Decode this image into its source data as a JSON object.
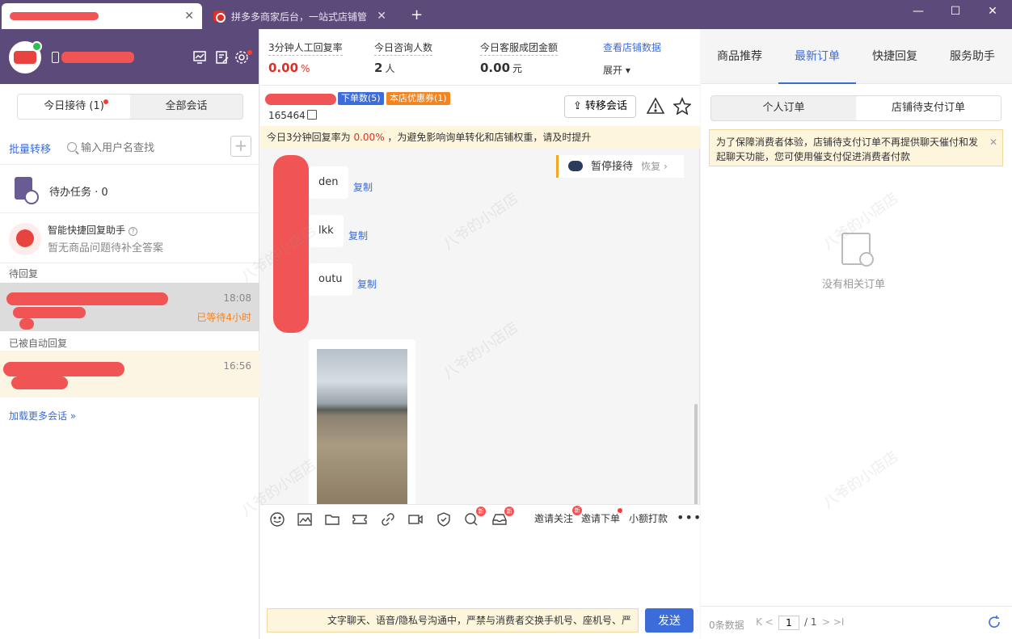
{
  "titlebar": {
    "tabs": [
      {
        "label": "拼多多商家后台，一站式店铺管"
      }
    ],
    "close_glyph": "✕",
    "new_tab": "+",
    "window_controls": [
      "—",
      "☐",
      "✕"
    ]
  },
  "left": {
    "reception_tabs": [
      "今日接待 (1)",
      "全部会话"
    ],
    "batch_transfer": "批量转移",
    "search_placeholder": "输入用户名查找",
    "add_glyph": "+",
    "todo": "待办任务 · 0",
    "assistant": {
      "title": "智能快捷回复助手",
      "subtitle": "暂无商品问题待补全答案"
    },
    "pending_label": "待回复",
    "pending_conv": {
      "time": "18:08",
      "wait": "已等待4小时"
    },
    "auto_label": "已被自动回复",
    "auto_conv": {
      "time": "16:56"
    },
    "load_more": "加载更多会话 »"
  },
  "stats": [
    {
      "label": "3分钟人工回复率",
      "value": "0.00",
      "unit": "%"
    },
    {
      "label": "今日咨询人数",
      "value": "2",
      "unit": "人"
    },
    {
      "label": "今日客服成团金额",
      "value": "0.00",
      "unit": "元"
    }
  ],
  "store_link": "查看店铺数据",
  "expand": "展开",
  "chat_header": {
    "badge_orders": "下单数(5)",
    "badge_coupon": "本店优惠券(1)",
    "buyer_id": "165464",
    "transfer": "转移会话"
  },
  "notice": {
    "prefix": "今日3分钟回复率为",
    "pct": "0.00%",
    "suffix": "，为避免影响询单转化和店铺权重，请及时提升"
  },
  "pause": {
    "label": "暂停接待",
    "restore": "恢复 ›"
  },
  "messages": [
    {
      "text": "den",
      "copy": "复制"
    },
    {
      "text": "lkk",
      "copy": "复制"
    },
    {
      "text": "outu",
      "copy": "复制"
    }
  ],
  "composer": {
    "new_badge": "新",
    "invite_follow": "邀请关注",
    "invite_order": "邀请下单",
    "small_pay": "小额打款",
    "more": "•••",
    "warning": "文字聊天、语音/隐私号沟通中，严禁与消费者交换手机号、座机号、严",
    "send": "发送"
  },
  "right": {
    "tabs": [
      "商品推荐",
      "最新订单",
      "快捷回复",
      "服务助手"
    ],
    "order_tabs": [
      "个人订单",
      "店铺待支付订单"
    ],
    "order_notice": "为了保障消费者体验，店铺待支付订单不再提供聊天催付和发起聊天功能，您可使用催支付促进消费者付款",
    "empty": "没有相关订单",
    "pager": {
      "count": "0条数据",
      "prev": "K <",
      "page": "1",
      "total": "/ 1",
      "next": "> >I"
    }
  },
  "watermark": "八爷的小店店",
  "colors": {
    "brand_purple": "#5c4a7a",
    "link_blue": "#3b6cd9",
    "alert_red": "#e02e24",
    "warn_orange": "#f5841f"
  }
}
